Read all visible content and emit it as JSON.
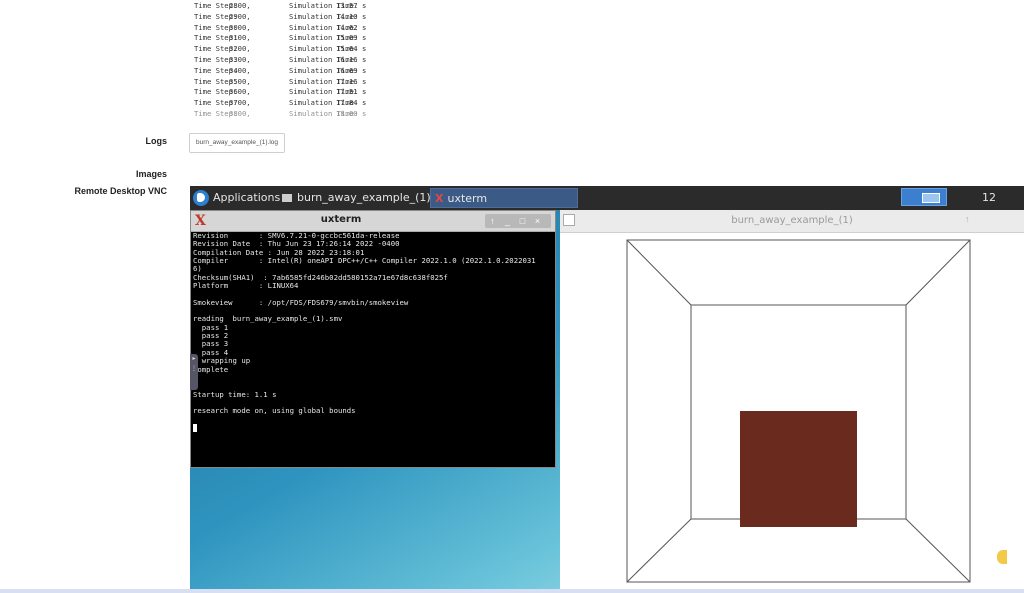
{
  "log": {
    "rows": [
      {
        "step_label": "Time Step:",
        "step": "2800,",
        "sim_label": "Simulation Time:",
        "time": "13.57 s"
      },
      {
        "step_label": "Time Step:",
        "step": "2900,",
        "sim_label": "Simulation Time:",
        "time": "14.10 s"
      },
      {
        "step_label": "Time Step:",
        "step": "3000,",
        "sim_label": "Simulation Time:",
        "time": "14.62 s"
      },
      {
        "step_label": "Time Step:",
        "step": "3100,",
        "sim_label": "Simulation Time:",
        "time": "15.09 s"
      },
      {
        "step_label": "Time Step:",
        "step": "3200,",
        "sim_label": "Simulation Time:",
        "time": "15.64 s"
      },
      {
        "step_label": "Time Step:",
        "step": "3300,",
        "sim_label": "Simulation Time:",
        "time": "16.16 s"
      },
      {
        "step_label": "Time Step:",
        "step": "3400,",
        "sim_label": "Simulation Time:",
        "time": "16.69 s"
      },
      {
        "step_label": "Time Step:",
        "step": "3500,",
        "sim_label": "Simulation Time:",
        "time": "17.16 s"
      },
      {
        "step_label": "Time Step:",
        "step": "3600,",
        "sim_label": "Simulation Time:",
        "time": "17.51 s"
      },
      {
        "step_label": "Time Step:",
        "step": "3700,",
        "sim_label": "Simulation Time:",
        "time": "17.84 s"
      }
    ],
    "cut_row": {
      "step_label": "Time Step:",
      "step": "3800,",
      "sim_label": "Simulation Time:",
      "time": "18.00 s"
    }
  },
  "labels": {
    "logs": "Logs",
    "images": "Images",
    "vnc": "Remote Desktop VNC"
  },
  "log_file": "burn_away_example_(1).log",
  "taskbar": {
    "applications": "Applications",
    "task1": "burn_away_example_(1)",
    "task2": "uxterm",
    "clock": "12"
  },
  "uxterm": {
    "title": "uxterm",
    "buttons": [
      "↑",
      "_",
      "□",
      "×"
    ],
    "lines": [
      "Revision       : SMV6.7.21-0-gccbc561da-release",
      "Revision Date  : Thu Jun 23 17:26:14 2022 -0400",
      "Compilation Date : Jun 28 2022 23:18:01",
      "Compiler       : Intel(R) oneAPI DPC++/C++ Compiler 2022.1.0 (2022.1.0.2022031",
      "6)",
      "Checksum(SHA1)  : 7ab6585fd246b02dd580152a71e67d8c638f025f",
      "Platform       : LINUX64",
      "",
      "Smokeview      : /opt/FDS/FDS679/smvbin/smokeview",
      "",
      "reading  burn_away_example_(1).smv",
      "  pass 1",
      "  pass 2",
      "  pass 3",
      "  pass 4",
      "  wrapping up",
      "complete",
      "",
      "",
      "Startup time: 1.1 s",
      "",
      "research mode on, using global bounds",
      ""
    ]
  },
  "smokeview": {
    "title": "burn_away_example_(1)",
    "up_arrow": "↑",
    "box_color": "#6b2a1e"
  },
  "colors": {
    "taskbar": "#2b2b2b",
    "active_task": "#3b5a86",
    "workspace": "#3d7fcf"
  }
}
